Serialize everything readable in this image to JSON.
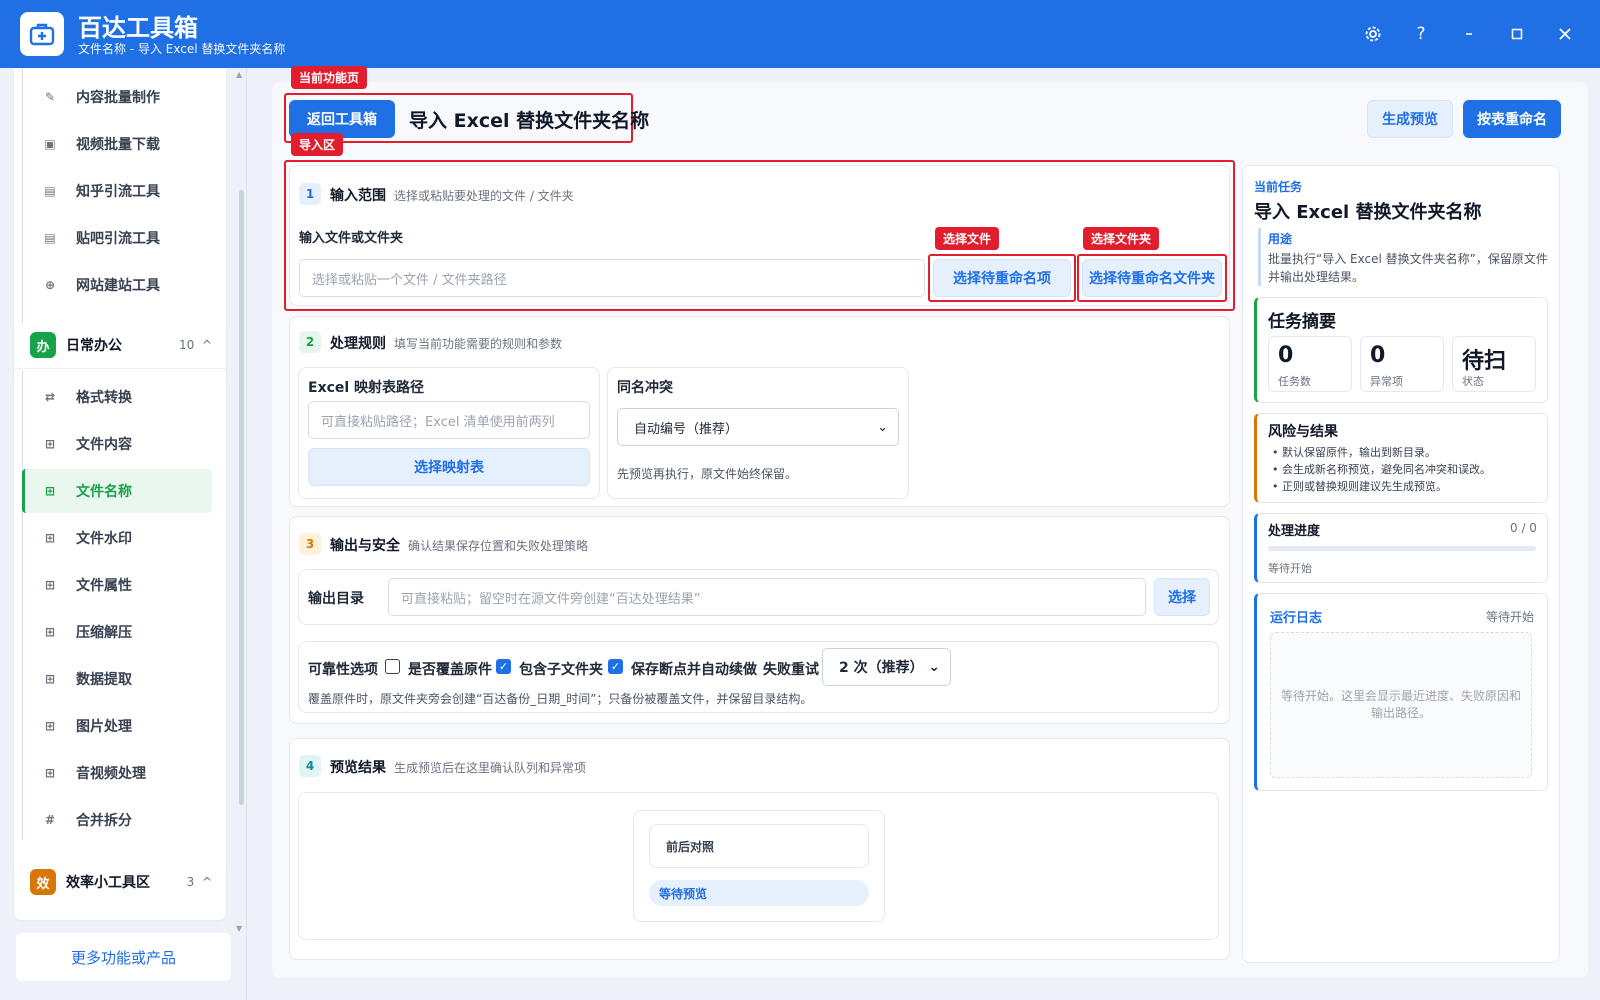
{
  "titlebar": {
    "app_name": "百达工具箱",
    "subtitle": "文件名称 - 导入 Excel 替换文件夹名称",
    "icons": [
      "gear-icon",
      "help-icon",
      "minimize-icon",
      "maximize-icon",
      "close-icon"
    ]
  },
  "sidebar": {
    "top_items": [
      {
        "label": "内容批量制作",
        "icon": "pen-icon"
      },
      {
        "label": "视频批量下载",
        "icon": "video-icon"
      },
      {
        "label": "知乎引流工具",
        "icon": "zhihu-icon"
      },
      {
        "label": "贴吧引流工具",
        "icon": "tieba-icon"
      },
      {
        "label": "网站建站工具",
        "icon": "globe-icon"
      }
    ],
    "group_office": {
      "badge": "办",
      "title": "日常办公",
      "count": "10",
      "chevron": "^"
    },
    "office_items": [
      {
        "label": "格式转换",
        "icon": "swap-icon"
      },
      {
        "label": "文件内容",
        "icon": "grid-icon"
      },
      {
        "label": "文件名称",
        "icon": "grid-icon",
        "active": true
      },
      {
        "label": "文件水印",
        "icon": "grid-icon"
      },
      {
        "label": "文件属性",
        "icon": "grid-icon"
      },
      {
        "label": "压缩解压",
        "icon": "grid-icon"
      },
      {
        "label": "数据提取",
        "icon": "grid-icon"
      },
      {
        "label": "图片处理",
        "icon": "grid-icon"
      },
      {
        "label": "音视频处理",
        "icon": "grid-icon"
      },
      {
        "label": "合并拆分",
        "icon": "hash-icon"
      }
    ],
    "group_efficiency": {
      "badge": "效",
      "title": "效率小工具区",
      "count": "3",
      "chevron": "^"
    },
    "more_link": "更多功能或产品"
  },
  "header": {
    "tag_current": "当前功能页",
    "back_button": "返回工具箱",
    "page_title": "导入 Excel 替换文件夹名称",
    "preview_button": "生成预览",
    "rename_button": "按表重命名"
  },
  "step1": {
    "tag": "导入区",
    "num": "1",
    "title": "输入范围",
    "desc": "选择或粘贴要处理的文件 / 文件夹",
    "field_label": "输入文件或文件夹",
    "input_placeholder": "选择或粘贴一个文件 / 文件夹路径",
    "tag_file": "选择文件",
    "tag_folder": "选择文件夹",
    "btn_select_items": "选择待重命名项",
    "btn_select_folder": "选择待重命名文件夹"
  },
  "step2": {
    "num": "2",
    "title": "处理规则",
    "desc": "填写当前功能需要的规则和参数",
    "excel_label": "Excel 映射表路径",
    "excel_placeholder": "可直接粘贴路径；Excel 清单使用前两列",
    "excel_button": "选择映射表",
    "conflict_label": "同名冲突",
    "conflict_value": "自动编号（推荐）",
    "conflict_hint": "先预览再执行，原文件始终保留。"
  },
  "step3": {
    "num": "3",
    "title": "输出与安全",
    "desc": "确认结果保存位置和失败处理策略",
    "output_label": "输出目录",
    "output_placeholder": "可直接粘贴；留空时在源文件旁创建“百达处理结果”",
    "output_button": "选择",
    "reliability_label": "可靠性选项",
    "opt_overwrite": "是否覆盖原件",
    "opt_subfolders": "包含子文件夹",
    "opt_resume": "保存断点并自动续做",
    "retry_label": "失败重试",
    "retry_value": "2 次（推荐）",
    "note": "覆盖原件时，原文件夹旁会创建“百达备份_日期_时间”；只备份被覆盖文件，并保留目录结构。"
  },
  "step4": {
    "num": "4",
    "title": "预览结果",
    "desc": "生成预览后在这里确认队列和异常项",
    "compare_label": "前后对照",
    "waiting_label": "等待预览"
  },
  "right": {
    "current_task_label": "当前任务",
    "task_title": "导入 Excel 替换文件夹名称",
    "usage_label": "用途",
    "usage_text": "批量执行“导入 Excel 替换文件夹名称”，保留原文件并输出处理结果。",
    "summary_title": "任务摘要",
    "stats": [
      {
        "value": "0",
        "label": "任务数"
      },
      {
        "value": "0",
        "label": "异常项"
      },
      {
        "value": "待扫",
        "label": "状态"
      }
    ],
    "risk_title": "风险与结果",
    "risk_items": [
      "默认保留原件，输出到新目录。",
      "会生成新名称预览，避免同名冲突和误改。",
      "正则或替换规则建议先生成预览。"
    ],
    "progress_title": "处理进度",
    "progress_count": "0 / 0",
    "progress_fraction": 0,
    "progress_status": "等待开始",
    "log_title": "运行日志",
    "log_status": "等待开始",
    "log_placeholder": "等待开始。这里会显示最近进度、失败原因和输出路径。"
  }
}
